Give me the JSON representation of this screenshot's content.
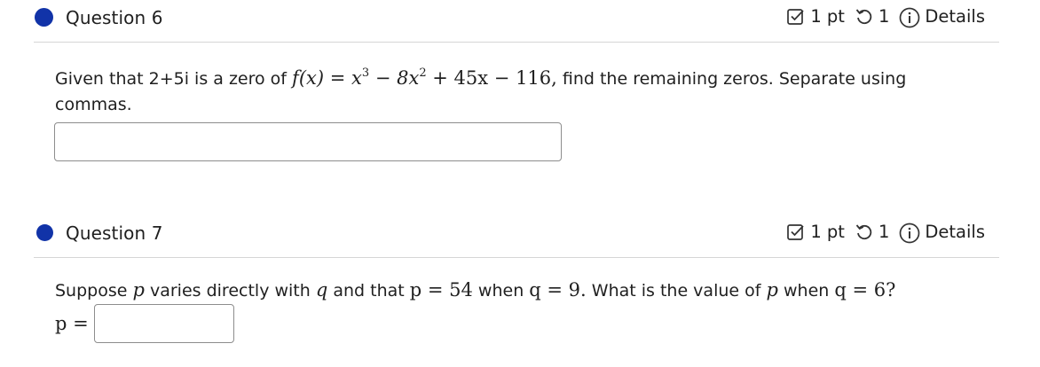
{
  "questions": [
    {
      "title": "Question 6",
      "points": "1 pt",
      "attempts": "1",
      "details_label": "Details",
      "prompt_before": "Given that 2+5i is a zero of",
      "math_f": "f(x)",
      "math_poly_a": "x",
      "math_poly_a_exp": "3",
      "math_poly_b": "8x",
      "math_poly_b_exp": "2",
      "math_poly_c": "+ 45x − 116,",
      "prompt_after": "find the remaining zeros. Separate using commas.",
      "answer_value": "",
      "answer_placeholder": ""
    },
    {
      "title": "Question 7",
      "points": "1 pt",
      "attempts": "1",
      "details_label": "Details",
      "prompt_1": "Suppose",
      "var_p": "p",
      "prompt_2": "varies directly with",
      "var_q": "q",
      "prompt_3": "and that",
      "eq_1": "p = 54",
      "prompt_4": "when",
      "eq_2": "q = 9.",
      "prompt_5": "What is the value of",
      "prompt_6": "when",
      "eq_3": "q = 6?",
      "answer_label": "p =",
      "answer_value": "",
      "answer_placeholder": ""
    }
  ],
  "colors": {
    "status_dot": "#1133a8",
    "divider": "#d5d5d5"
  }
}
